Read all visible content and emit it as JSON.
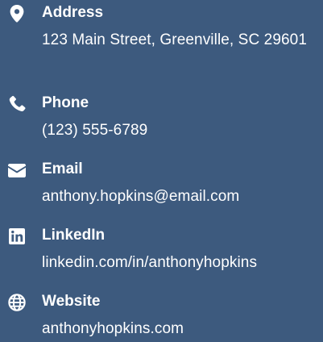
{
  "contacts": [
    {
      "icon": "map-marker-icon",
      "label": "Address",
      "value": "123 Main Street, Greenville, SC 29601"
    },
    {
      "icon": "phone-icon",
      "label": "Phone",
      "value": "(123) 555-6789"
    },
    {
      "icon": "envelope-icon",
      "label": "Email",
      "value": "anthony.hopkins@email.com"
    },
    {
      "icon": "linkedin-icon",
      "label": "LinkedIn",
      "value": "linkedin.com/in/anthonyhopkins"
    },
    {
      "icon": "globe-icon",
      "label": "Website",
      "value": "anthonyhopkins.com"
    }
  ],
  "colors": {
    "background": "#3d5a7e",
    "text": "#ffffff"
  }
}
